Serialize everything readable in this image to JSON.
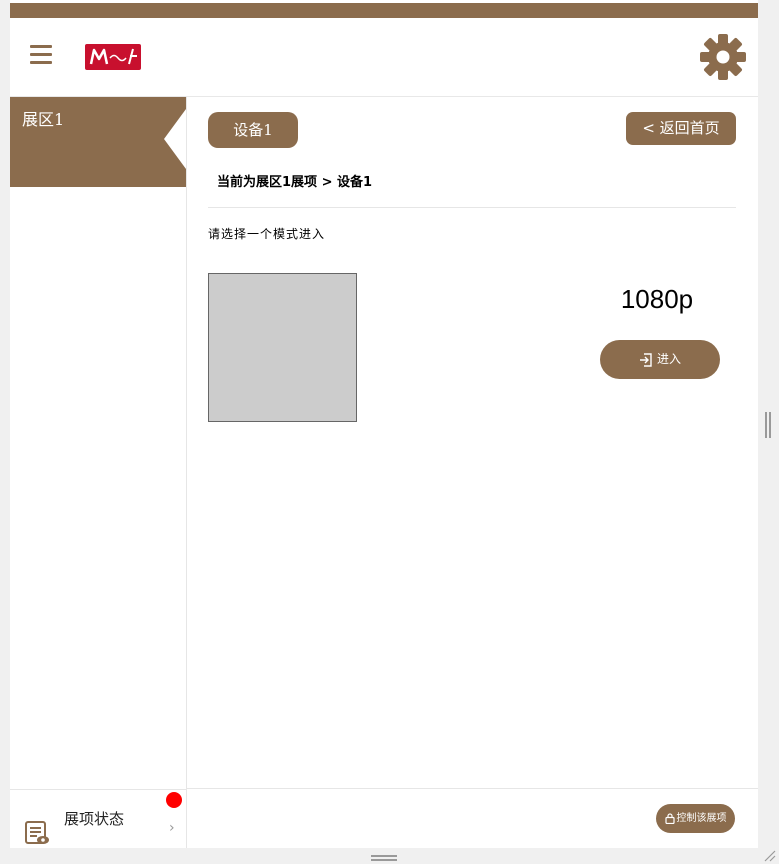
{
  "colors": {
    "accent": "#8b6c4d",
    "badge": "#ff0000",
    "thumbnail": "#cccccc"
  },
  "header": {
    "menu_icon": "hamburger-icon",
    "logo_icon": "brand-logo",
    "settings_icon": "gear-icon"
  },
  "sidebar": {
    "items": [
      {
        "label": "展区1",
        "selected": true
      }
    ],
    "status": {
      "label": "展项状态",
      "icon": "report-eye-icon",
      "arrow": "›",
      "has_notification": true
    }
  },
  "main": {
    "device_tab": "设备1",
    "home_button": "< 返回首页",
    "breadcrumb": "当前为展区1展项 > 设备1",
    "prompt": "请选择一个模式进入",
    "modes": [
      {
        "resolution": "1080p",
        "enter_label": "进入",
        "enter_icon": "enter-icon"
      }
    ]
  },
  "footer": {
    "control_button": "控制该展项",
    "control_icon": "lock-icon"
  }
}
